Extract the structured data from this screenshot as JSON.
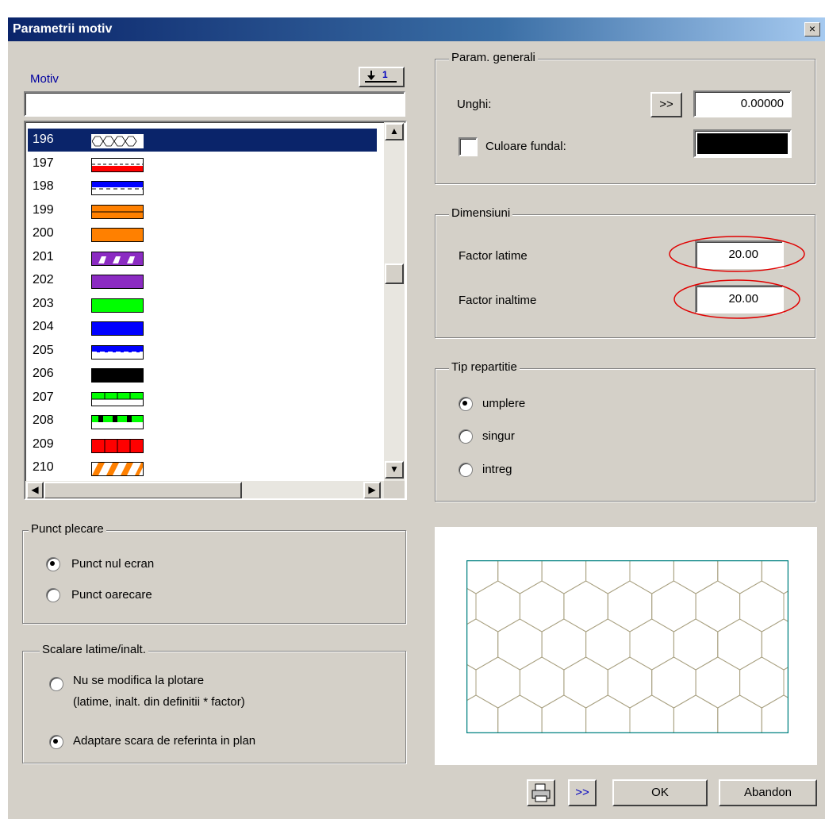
{
  "window": {
    "title": "Parametrii motiv",
    "close_label": "×"
  },
  "motiv": {
    "header": "Motiv",
    "sort_icon_label": "1",
    "filter_value": "",
    "items": [
      {
        "num": "196",
        "selected": true
      },
      {
        "num": "197"
      },
      {
        "num": "198"
      },
      {
        "num": "199"
      },
      {
        "num": "200"
      },
      {
        "num": "201"
      },
      {
        "num": "202"
      },
      {
        "num": "203"
      },
      {
        "num": "204"
      },
      {
        "num": "205"
      },
      {
        "num": "206"
      },
      {
        "num": "207"
      },
      {
        "num": "208"
      },
      {
        "num": "209"
      },
      {
        "num": "210"
      }
    ],
    "colors": {
      "red": "#ff0000",
      "blue": "#0000ff",
      "orange": "#ff8000",
      "purple": "#8b2bc2",
      "green": "#00ff00",
      "black": "#000000",
      "white": "#ffffff"
    }
  },
  "param_generali": {
    "legend": "Param. generali",
    "unghi_label": "Unghi:",
    "unghi_button": ">>",
    "unghi_value": "0.00000",
    "culoare_label": "Culoare fundal:",
    "culoare_checked": false,
    "culoare_value": "#000000"
  },
  "dimensiuni": {
    "legend": "Dimensiuni",
    "latime_label": "Factor latime",
    "latime_value": "20.00",
    "inaltime_label": "Factor inaltime",
    "inaltime_value": "20.00",
    "highlight_color": "#e00000"
  },
  "tip_repartitie": {
    "legend": "Tip repartitie",
    "options": [
      "umplere",
      "singur",
      "intreg"
    ],
    "selected": "umplere"
  },
  "punct_plecare": {
    "legend": "Punct plecare",
    "options": [
      "Punct nul ecran",
      "Punct oarecare"
    ],
    "selected": "Punct nul ecran"
  },
  "scalare": {
    "legend": "Scalare latime/inalt.",
    "option1_line1": "Nu se modifica la plotare",
    "option1_line2": "(latime, inalt. din definitii * factor)",
    "option2": "Adaptare scara de referinta in plan",
    "selected": "option2"
  },
  "preview": {
    "pattern": "hexagon",
    "line_color": "#a8a080",
    "frame_color": "#008080"
  },
  "buttons": {
    "print_icon": "printer-icon",
    "more_label": ">>",
    "ok_label": "OK",
    "cancel_label": "Abandon"
  }
}
